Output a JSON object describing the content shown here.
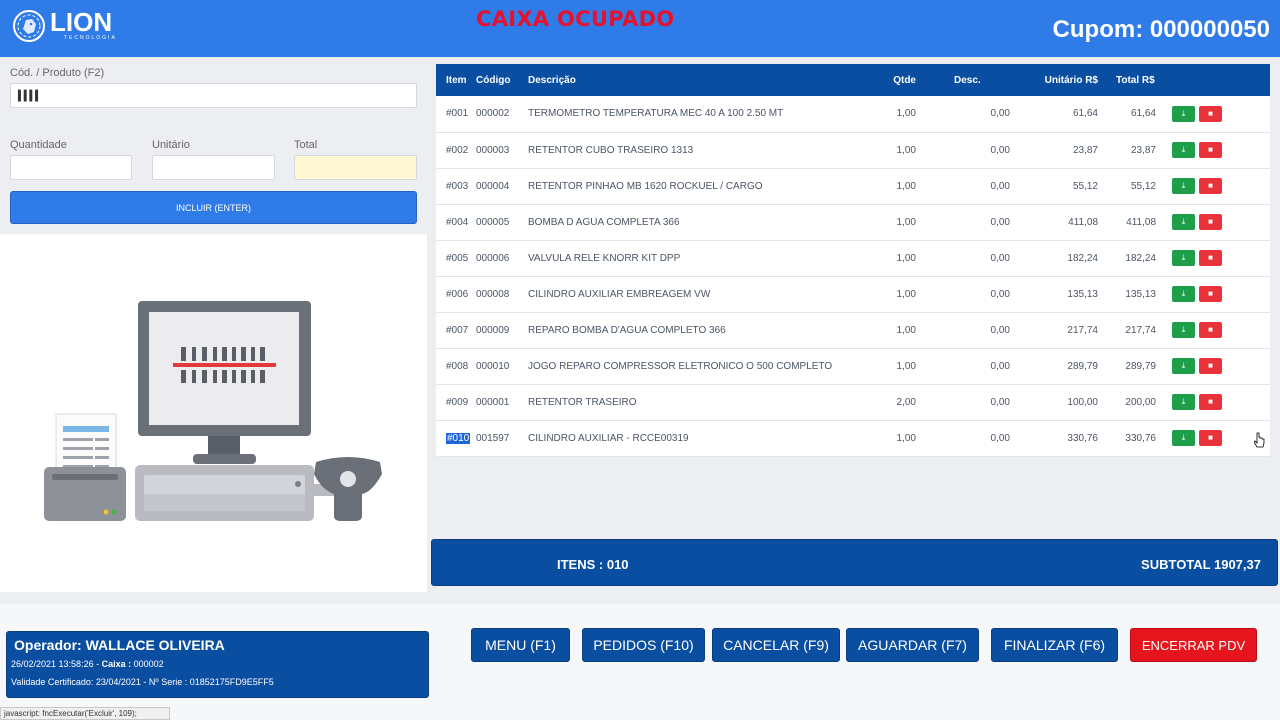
{
  "header": {
    "logo_text": "LION",
    "logo_subtext": "TECNOLOGIA",
    "status_title": "CAIXA OCUPADO",
    "cupom_label": "Cupom: 000000050"
  },
  "form": {
    "product_label": "Cód. / Produto (F2)",
    "product_value": "",
    "quantity_label": "Quantidade",
    "unit_label": "Unitário",
    "total_label": "Total",
    "include_button": "INCLUIR (ENTER)"
  },
  "table": {
    "headers": [
      "Item",
      "Código",
      "Descrição",
      "Qtde",
      "Desc.",
      "Unitário R$",
      "Total R$"
    ],
    "rows": [
      {
        "item": "#001",
        "codigo": "000002",
        "descricao": "TERMOMETRO TEMPERATURA MEC 40 A 100 2.50 MT",
        "qtde": "1,00",
        "desc": "0,00",
        "unitario": "61,64",
        "total": "61,64"
      },
      {
        "item": "#002",
        "codigo": "000003",
        "descricao": "RETENTOR CUBO TRASEIRO 1313",
        "qtde": "1,00",
        "desc": "0,00",
        "unitario": "23,87",
        "total": "23,87"
      },
      {
        "item": "#003",
        "codigo": "000004",
        "descricao": "RETENTOR PINHAO MB 1620 ROCKUEL / CARGO",
        "qtde": "1,00",
        "desc": "0,00",
        "unitario": "55,12",
        "total": "55,12"
      },
      {
        "item": "#004",
        "codigo": "000005",
        "descricao": "BOMBA D AGUA COMPLETA 366",
        "qtde": "1,00",
        "desc": "0,00",
        "unitario": "411,08",
        "total": "411,08"
      },
      {
        "item": "#005",
        "codigo": "000006",
        "descricao": "VALVULA RELE KNORR KIT DPP",
        "qtde": "1,00",
        "desc": "0,00",
        "unitario": "182,24",
        "total": "182,24"
      },
      {
        "item": "#006",
        "codigo": "000008",
        "descricao": "CILINDRO AUXILIAR EMBREAGEM VW",
        "qtde": "1,00",
        "desc": "0,00",
        "unitario": "135,13",
        "total": "135,13"
      },
      {
        "item": "#007",
        "codigo": "000009",
        "descricao": "REPARO BOMBA D'AGUA COMPLETO 366",
        "qtde": "1,00",
        "desc": "0,00",
        "unitario": "217,74",
        "total": "217,74"
      },
      {
        "item": "#008",
        "codigo": "000010",
        "descricao": "JOGO REPARO COMPRESSOR ELETRONICO O 500 COMPLETO",
        "qtde": "1,00",
        "desc": "0,00",
        "unitario": "289,79",
        "total": "289,79"
      },
      {
        "item": "#009",
        "codigo": "000001",
        "descricao": "RETENTOR TRASEIRO",
        "qtde": "2,00",
        "desc": "0,00",
        "unitario": "100,00",
        "total": "200,00"
      },
      {
        "item": "#010",
        "codigo": "001597",
        "descricao": "CILINDRO AUXILIAR - RCCE00319",
        "qtde": "1,00",
        "desc": "0,00",
        "unitario": "330,76",
        "total": "330,76"
      }
    ],
    "edit_icon": "download-icon",
    "delete_icon": "trash-icon",
    "selected_row_index": 9
  },
  "summary": {
    "items_label": "ITENS : 010",
    "subtotal_label": "SUBTOTAL 1907,37"
  },
  "operator": {
    "name_line": "Operador: WALLACE OLIVEIRA",
    "datetime": "26/02/2021 13:58:26",
    "caixa_label": "Caixa :",
    "caixa_value": "000002",
    "cert_line": "Validade Certificado: 23/04/2021 - Nº Serie : 01852175FD9E5FF5"
  },
  "buttons": {
    "menu": "MENU (F1)",
    "pedidos": "PEDIDOS (F10)",
    "cancelar": "CANCELAR (F9)",
    "aguardar": "AGUARDAR (F7)",
    "finalizar": "FINALIZAR (F6)",
    "encerrar": "ENCERRAR PDV"
  },
  "statusbar": {
    "text": "javascript: fncExecutar('Excluir', 109);"
  },
  "colors": {
    "header_blue": "#2f7be8",
    "dark_blue": "#0a4ea2",
    "status_red": "#e8112d",
    "green_action": "#1e9e48",
    "red_action": "#e8333b",
    "close_pdv_red": "#e5141d"
  }
}
